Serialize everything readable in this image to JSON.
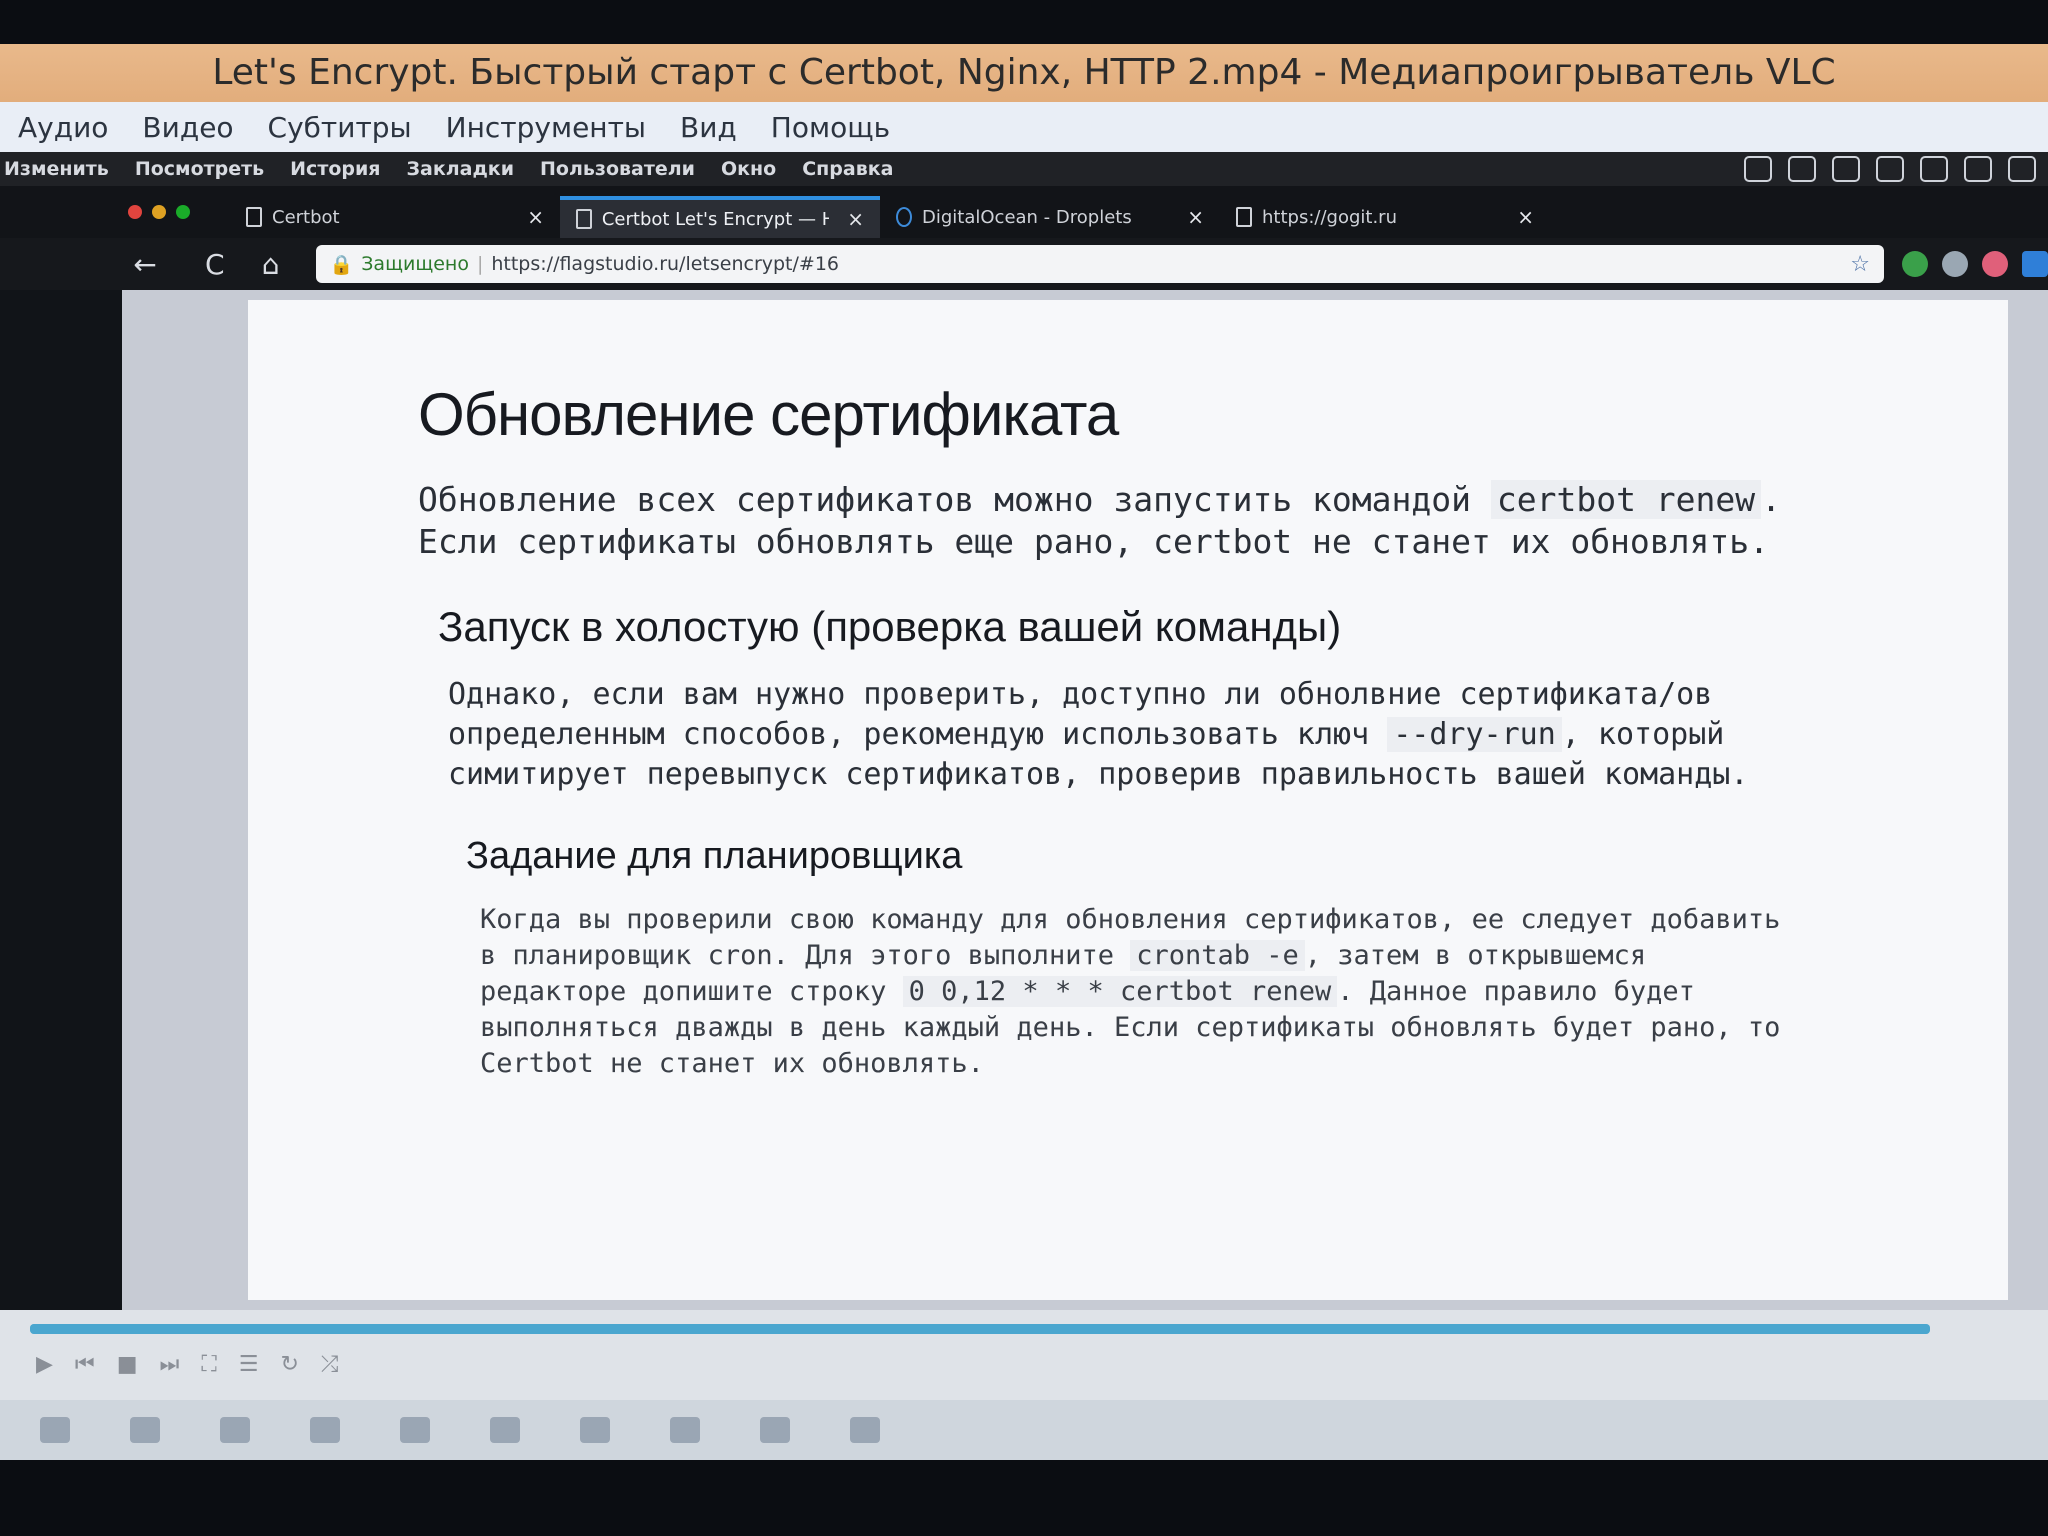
{
  "vlc": {
    "title": "Let's Encrypt. Быстрый старт с Certbot, Nginx, HTTP 2.mp4 - Медиапроигрыватель VLC",
    "menu": [
      "Аудио",
      "Видео",
      "Субтитры",
      "Инструменты",
      "Вид",
      "Помощь"
    ]
  },
  "browser": {
    "mac_menu": [
      "Изменить",
      "Посмотреть",
      "История",
      "Закладки",
      "Пользователи",
      "Окно",
      "Справка"
    ],
    "tabs": [
      {
        "label": "Certbot"
      },
      {
        "label": "Certbot Let's Encrypt — HTTP"
      },
      {
        "label": "DigitalOcean - Droplets"
      },
      {
        "label": "https://gogit.ru"
      }
    ],
    "tab_close": "×",
    "secure_label": "Защищено",
    "url": "https://flagstudio.ru/letsencrypt/#16",
    "star": "☆",
    "back": "←",
    "reload": "C",
    "home": "⌂"
  },
  "slide": {
    "title": "Обновление сертификата",
    "p1_a": "Обновление всех сертификатов можно запустить командой ",
    "p1_code": "certbot renew",
    "p1_b": ". Если сертификаты обновлять еще рано, certbot не станет их обновлять.",
    "h2_dry": "Запуск в холостую (проверка вашей команды)",
    "p2_a": "Однако, если вам нужно проверить, доступно ли обнолвние сертификата/ов определенным способов, рекомендую использовать ключ ",
    "p2_code": "--dry-run",
    "p2_b": ", который симитирует перевыпуск сертификатов, проверив правильность вашей команды.",
    "h2_cron": "Задание для планировщика",
    "p3_a": "Когда вы проверили свою команду для обновления сертификатов, ее следует добавить в планировщик cron. Для этого выполните ",
    "p3_code1": "crontab -e",
    "p3_b": ", затем в открывшемся редакторе допишите строку ",
    "p3_code2": "0 0,12 * * * certbot renew",
    "p3_c": ". Данное правило будет выполняться дважды в день каждый день. Если сертификаты обновлять будет рано, то Certbot не станет их обновлять."
  },
  "player": {
    "progress": 1.0,
    "seek_color": "#4aa6cf"
  }
}
